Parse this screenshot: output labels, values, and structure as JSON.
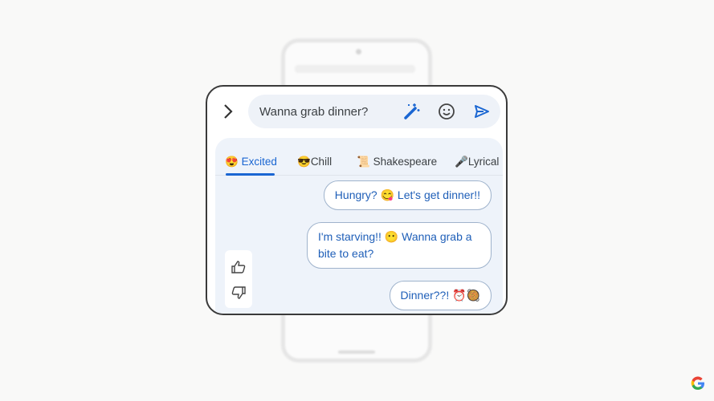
{
  "compose": {
    "input_value": "Wanna grab dinner?",
    "icons": [
      "chevron-right-icon",
      "magic-wand-icon",
      "emoji-icon",
      "send-icon"
    ]
  },
  "tabs": [
    {
      "emoji": "😍",
      "label": "Excited",
      "active": true
    },
    {
      "emoji": "😎",
      "label": "Chill"
    },
    {
      "emoji": "📜",
      "label": "Shakespeare"
    },
    {
      "emoji": "🎤",
      "label": "Lyrical"
    }
  ],
  "suggestions": [
    {
      "text": "Hungry? 😋 Let's get dinner!!"
    },
    {
      "text": "I'm starving!! 😶 Wanna grab a bite to eat?"
    },
    {
      "text": "Dinner??! ⏰🥘"
    }
  ],
  "feedback": [
    "thumbs-up-icon",
    "thumbs-down-icon"
  ],
  "colors": {
    "accent": "#1a66d2",
    "bubble_text": "#1f5fb8",
    "panel_bg": "#eef3fa"
  }
}
